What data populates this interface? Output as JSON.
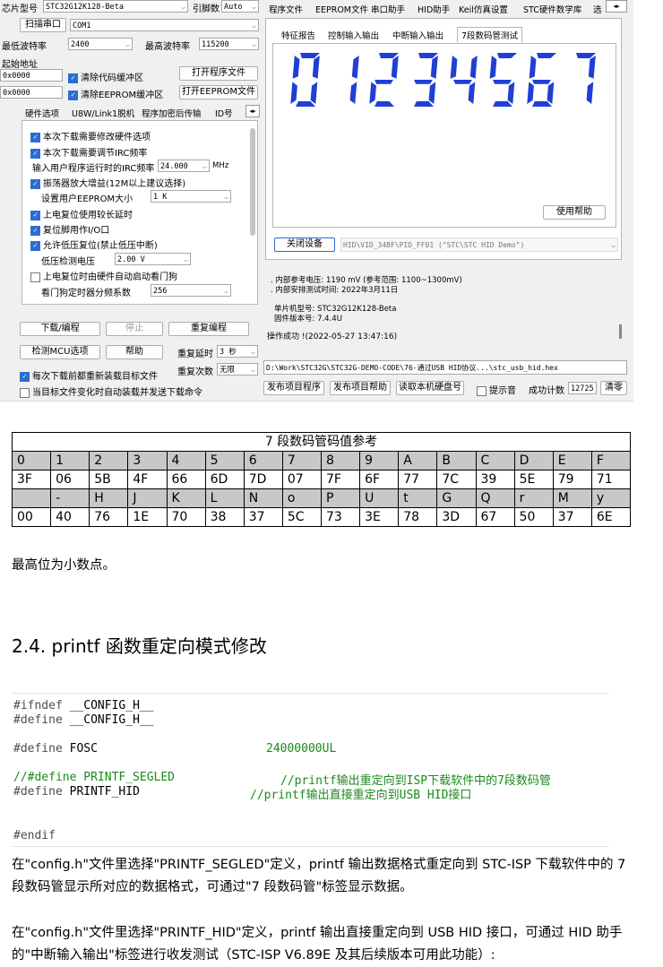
{
  "isp": {
    "chip_label": "芯片型号",
    "chip_value": "STC32G12K128-Beta",
    "pin_label": "引脚数",
    "pin_value": "Auto",
    "scan_button": "扫描串口",
    "port_value": "COM1",
    "min_baud_label": "最低波特率",
    "min_baud_value": "2400",
    "max_baud_label": "最高波特率",
    "max_baud_value": "115200",
    "start_addr_label": "起始地址",
    "addr1": "0x0000",
    "clear_code": "清除代码缓冲区",
    "open_prog": "打开程序文件",
    "addr2": "0x0000",
    "clear_eeprom": "清除EEPROM缓冲区",
    "open_eeprom": "打开EEPROM文件",
    "left_tabs": [
      "硬件选项",
      "U8W/Link1脱机",
      "程序加密后传输",
      "ID号"
    ],
    "options": [
      {
        "text": "本次下载需要修改硬件选项",
        "checked": true
      },
      {
        "text": "本次下载需要调节IRC频率",
        "checked": true
      },
      {
        "text": "输入用户程序运行时的IRC频率",
        "value": "24.000",
        "unit": "MHz"
      },
      {
        "text": "振荡器放大增益(12M以上建议选择)",
        "checked": true
      },
      {
        "text": "设置用户EEPROM大小",
        "value": "1    K"
      },
      {
        "text": "上电复位使用较长延时",
        "checked": true
      },
      {
        "text": "复位脚用作I/O口",
        "checked": true
      },
      {
        "text": "允许低压复位(禁止低压中断)",
        "checked": true
      },
      {
        "text": "低压检测电压",
        "value": "2.00 V"
      },
      {
        "text": "上电复位时由硬件自动启动看门狗",
        "checked": false
      },
      {
        "text": "看门狗定时器分频系数",
        "value": "256"
      }
    ],
    "download_button": "下载/编程",
    "stop_button": "停止",
    "reprogram_button": "重复编程",
    "detect_button": "检测MCU选项",
    "help_button": "帮助",
    "repeat_delay_label": "重复延时",
    "repeat_delay_value": "3 秒",
    "repeat_count_label": "重复次数",
    "repeat_count_value": "无限",
    "reload_each": "每次下载前都重新装载目标文件",
    "auto_send": "当目标文件变化时自动装载并发送下载命令",
    "top_tabs": [
      "程序文件",
      "EEPROM文件",
      "串口助手",
      "HID助手",
      "Keil仿真设置",
      "STC硬件数学库",
      "选"
    ],
    "sub_tabs": [
      "特征报告",
      "控制输入输出",
      "中断输入输出",
      "7段数码管测试"
    ],
    "digits": "01234567",
    "use_help": "使用帮助",
    "close_device": "关闭设备",
    "device_value": "HID\\VID_34BF\\PID_FF01 (\"STC\\STC HID Demo\")",
    "log_lines": [
      ". 内部参考电压: 1190 mV (参考范围: 1100~1300mV)",
      ". 内部安排测试时间: 2022年3月11日",
      "单片机型号: STC32G12K128-Beta",
      "固件版本号: 7.4.4U",
      "操作成功 !(2022-05-27 13:47:16)"
    ],
    "file_path": "D:\\Work\\STC32G\\STC32G-DEMO-CODE\\76-通过USB HID协议...\\stc_usb_hid.hex",
    "publish_program": "发布项目程序",
    "publish_help": "发布项目帮助",
    "read_disk": "读取本机硬盘号",
    "beep_label": "提示音",
    "success_label": "成功计数",
    "success_value": "12725",
    "clear_button": "清零"
  },
  "table": {
    "caption": "7 段数码管码值参考",
    "rows": [
      [
        "0",
        "1",
        "2",
        "3",
        "4",
        "5",
        "6",
        "7",
        "8",
        "9",
        "A",
        "B",
        "C",
        "D",
        "E",
        "F"
      ],
      [
        "3F",
        "06",
        "5B",
        "4F",
        "66",
        "6D",
        "7D",
        "07",
        "7F",
        "6F",
        "77",
        "7C",
        "39",
        "5E",
        "79",
        "71"
      ],
      [
        "",
        "-",
        "H",
        "J",
        "K",
        "L",
        "N",
        "o",
        "P",
        "U",
        "t",
        "G",
        "Q",
        "r",
        "M",
        "y"
      ],
      [
        "00",
        "40",
        "76",
        "1E",
        "70",
        "38",
        "37",
        "5C",
        "73",
        "3E",
        "78",
        "3D",
        "67",
        "50",
        "37",
        "6E"
      ]
    ]
  },
  "note": "最高位为小数点。",
  "heading": "2.4.  printf 函数重定向模式修改",
  "code": {
    "l1_kw": "#ifndef",
    "l1_rest": " __CONFIG_H__",
    "l2_kw": "#define",
    "l2_rest": " __CONFIG_H__",
    "l3_kw": "#define",
    "l3_name": " FOSC",
    "l3_val": "24000000UL",
    "l4": "//#define PRINTF_SEGLED",
    "l4_comment": "//printf输出重定向到ISP下载软件中的7段数码管",
    "l5_kw": "#define",
    "l5_name": " PRINTF_HID",
    "l5_comment": "//printf输出直接重定向到USB HID接口",
    "l6": "#endif"
  },
  "para1": "在\"config.h\"文件里选择\"PRINTF_SEGLED\"定义，printf 输出数据格式重定向到 STC-ISP 下载软件中的 7 段数码管显示所对应的数据格式，可通过\"7 段数码管\"标签显示数据。",
  "para2": "在\"config.h\"文件里选择\"PRINTF_HID\"定义，printf 输出直接重定向到 USB HID 接口，可通过 HID 助手的\"中断输入输出\"标签进行收发测试（STC-ISP V6.89E 及其后续版本可用此功能）:"
}
